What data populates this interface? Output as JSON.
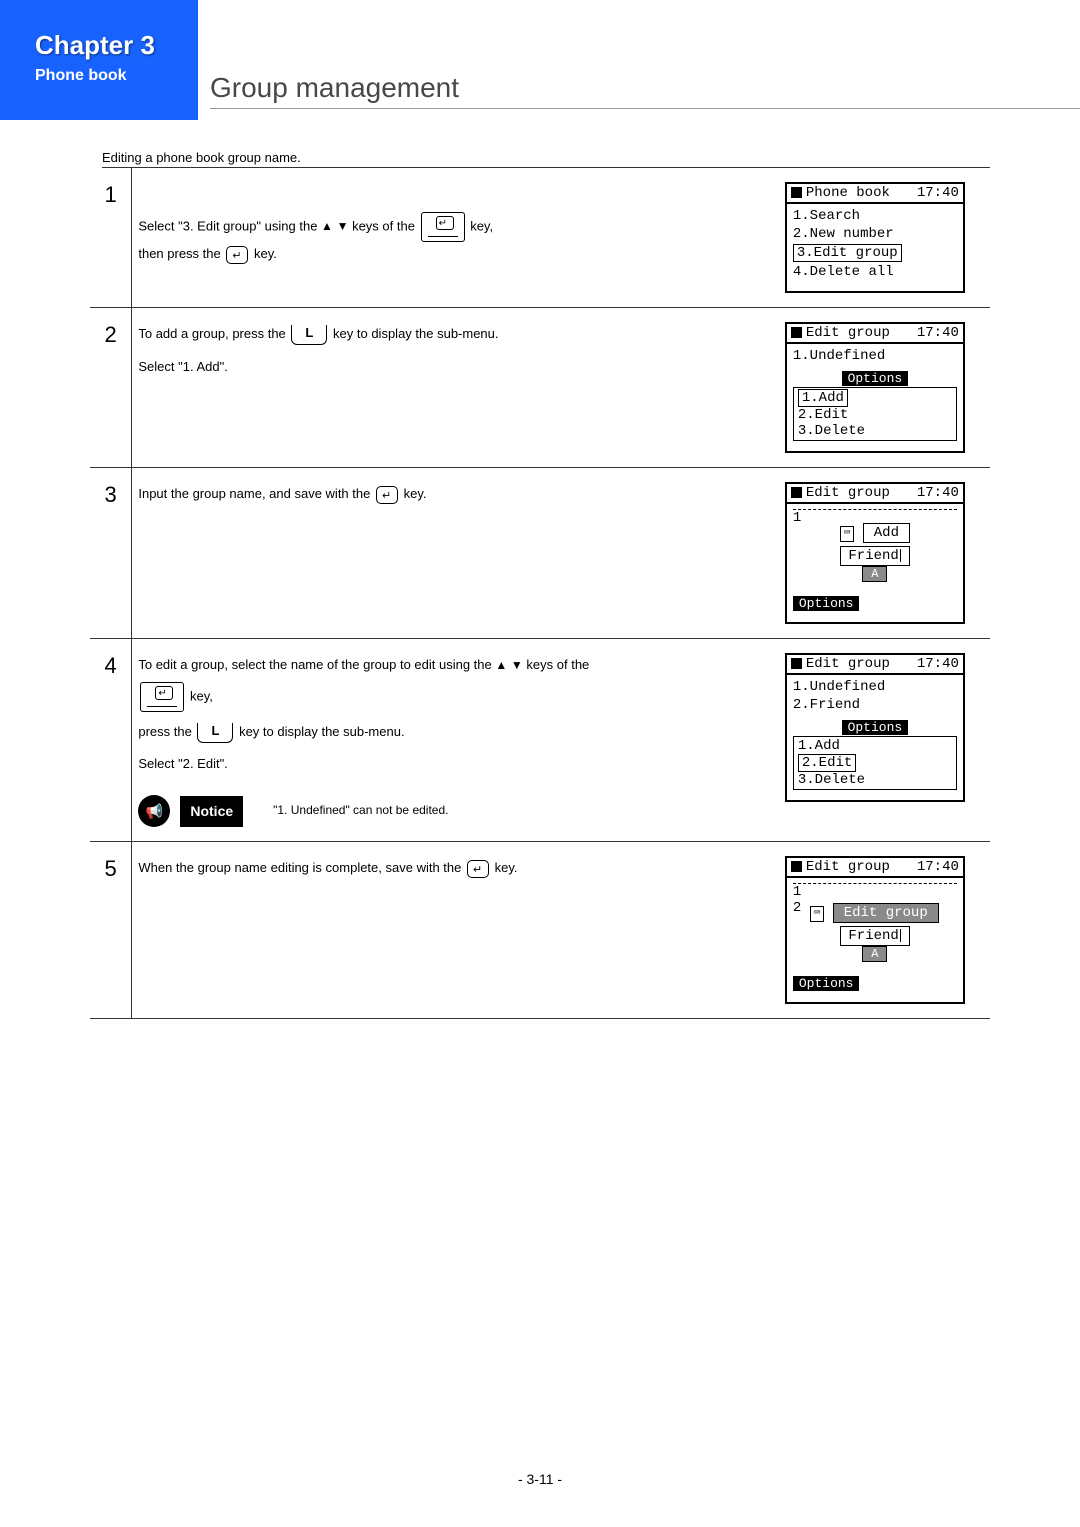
{
  "chapter": {
    "title": "Chapter 3",
    "subtitle": "Phone book"
  },
  "pageTitle": "Group management",
  "intro": "Editing a phone book group name.",
  "steps": [
    {
      "num": "1",
      "text": {
        "a": "Select \"3. Edit group\" using the ",
        "b": " keys of the ",
        "c": " key,",
        "d": "then press the ",
        "e": " key."
      },
      "screen": {
        "title": "Phone book",
        "time": "17:40",
        "rows": [
          "1.Search",
          "2.New number",
          "3.Edit group",
          "4.Delete all"
        ],
        "highlight": 2
      }
    },
    {
      "num": "2",
      "text": {
        "a": "To add a group, press the ",
        "b": " key to display the sub-menu.",
        "c": "Select \"1. Add\"."
      },
      "screen": {
        "title": "Edit group",
        "time": "17:40",
        "rows": [
          "1.Undefined"
        ],
        "optsTitle": "Options",
        "opts": [
          "1.Add",
          "2.Edit",
          "3.Delete"
        ],
        "optHighlight": 0
      }
    },
    {
      "num": "3",
      "text": {
        "a": "Input the group name, and save with the ",
        "b": " key."
      },
      "screen": {
        "title": "Edit group",
        "time": "17:40",
        "popupTitle": "Add",
        "input": "Friend",
        "mode": "A",
        "footerBtn": "Options",
        "lead": "1"
      }
    },
    {
      "num": "4",
      "text": {
        "a": "To edit a group, select the name of the group to edit using the ",
        "b": " keys of the",
        "c": " key,",
        "d": "press the ",
        "e": " key to display the sub-menu.",
        "f": "Select \"2. Edit\"."
      },
      "notice": {
        "label": "Notice",
        "text": "\"1. Undefined\" can not be edited."
      },
      "screen": {
        "title": "Edit group",
        "time": "17:40",
        "rows": [
          "1.Undefined",
          "2.Friend"
        ],
        "optsTitle": "Options",
        "opts": [
          "1.Add",
          "2.Edit",
          "3.Delete"
        ],
        "optHighlight": 1
      }
    },
    {
      "num": "5",
      "text": {
        "a": "When the group name editing is complete, save with the ",
        "b": " key."
      },
      "screen": {
        "title": "Edit group",
        "time": "17:40",
        "popupTitle": "Edit group",
        "input": "Friend",
        "mode": "A",
        "footerBtn": "Options",
        "lead1": "1",
        "lead2": "2"
      }
    }
  ],
  "footer": "- 3-11 -"
}
